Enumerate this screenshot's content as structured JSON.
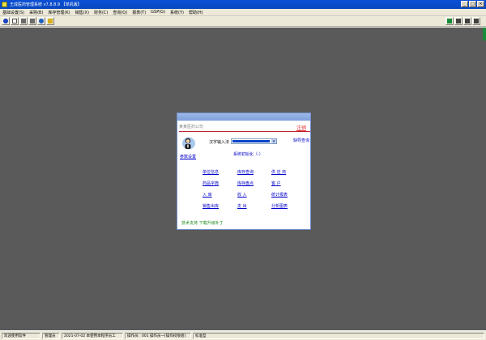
{
  "window": {
    "title": "王成医药管理系统 v7.8.8.9 【单机版】",
    "buttons": [
      "_",
      "□",
      "×"
    ]
  },
  "menu": [
    {
      "label": "基础设置(S)"
    },
    {
      "label": "采购(B)"
    },
    {
      "label": "库存管理(K)"
    },
    {
      "label": "销售(X)"
    },
    {
      "label": "财务(C)"
    },
    {
      "label": "查询(Q)"
    },
    {
      "label": "报表(T)"
    },
    {
      "label": "GSP(G)"
    },
    {
      "label": "系统(Y)"
    },
    {
      "label": "帮助(H)"
    }
  ],
  "toolbar": {
    "left": [
      {
        "icon": "back-icon",
        "color": "#1a3fbf"
      },
      {
        "icon": "document-icon",
        "color": "#ffffff"
      },
      {
        "icon": "tools-icon",
        "color": "#6b6b6b"
      },
      {
        "icon": "chart-icon",
        "color": "#6b6b6b"
      },
      {
        "icon": "search-icon",
        "color": "#2060c0"
      },
      {
        "icon": "book-icon",
        "color": "#d8b020"
      }
    ],
    "right": [
      {
        "icon": "person-icon",
        "color": "#1a8a3a"
      },
      {
        "icon": "notes-icon",
        "color": "#404040"
      },
      {
        "icon": "calculator-icon",
        "color": "#404040"
      },
      {
        "icon": "settings-icon",
        "color": "#404040"
      },
      {
        "icon": "exit-icon",
        "color": "#404040"
      }
    ]
  },
  "dialog": {
    "company": "某某医药公司",
    "logout": "注销",
    "avatar_label": "参数设置",
    "ime_label": "汉字输入法",
    "stock_query": "缺导查询",
    "system_init": "系统初始化（-）",
    "links": [
      {
        "label": "单位信息"
      },
      {
        "label": "库存查询"
      },
      {
        "label": "供 应 商"
      },
      {
        "label": "药品字典"
      },
      {
        "label": "库存盘点"
      },
      {
        "label": "客    户"
      },
      {
        "label": "入    库"
      },
      {
        "label": "收    入"
      },
      {
        "label": "统计报表"
      },
      {
        "label": "销售出库"
      },
      {
        "label": "支    出"
      },
      {
        "label": "分析图表"
      }
    ],
    "footer": "技术支持  下载升级补丁"
  },
  "statusbar": [
    {
      "text": "欢迎使用软件"
    },
    {
      "text": "管理员"
    },
    {
      "text": "2021-07-02 本使用本程序员工"
    },
    {
      "text": "操作员：001 操作员一[操作权限组]"
    },
    {
      "text": "标准型"
    }
  ]
}
